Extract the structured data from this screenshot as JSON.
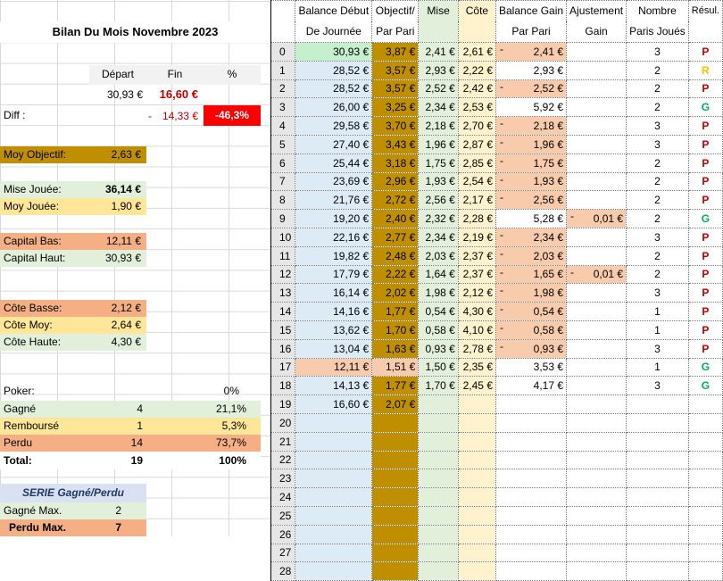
{
  "title": "Bilan Du Mois Novembre 2023",
  "summary": {
    "col_headers": [
      "Départ",
      "Fin",
      "%"
    ],
    "depart": "30,93 €",
    "fin": "16,60 €",
    "diff_label": "Diff :",
    "diff_dash": "-",
    "diff_value": "14,33 €",
    "diff_pct": "-46,3%"
  },
  "stats": {
    "moy_objectif": {
      "label": "Moy Objectif:",
      "value": "2,63 €"
    },
    "mise_jouee": {
      "label": "Mise Jouée:",
      "value": "36,14 €"
    },
    "moy_jouee": {
      "label": "Moy Jouée:",
      "value": "1,90 €"
    },
    "capital_bas": {
      "label": "Capital Bas:",
      "value": "12,11 €"
    },
    "capital_haut": {
      "label": "Capital Haut:",
      "value": "30,93 €"
    },
    "cote_basse": {
      "label": "Côte Basse:",
      "value": "2,12 €"
    },
    "cote_moy": {
      "label": "Côte Moy:",
      "value": "2,64 €"
    },
    "cote_haute": {
      "label": "Côte Haute:",
      "value": "4,30 €"
    }
  },
  "results": {
    "poker": {
      "label": "Poker:",
      "count": "",
      "pct": "0%"
    },
    "gagne": {
      "label": "Gagné",
      "count": "4",
      "pct": "21,1%"
    },
    "rembourse": {
      "label": "Remboursé",
      "count": "1",
      "pct": "5,3%"
    },
    "perdu": {
      "label": "Perdu",
      "count": "14",
      "pct": "73,7%"
    },
    "total": {
      "label": "Total:",
      "count": "19",
      "pct": "100%"
    }
  },
  "serie": {
    "title": "SERIE Gagné/Perdu",
    "gagne_max": {
      "label": "Gagné Max.",
      "value": "2"
    },
    "perdu_max": {
      "label": "Perdu Max.",
      "value": "7"
    }
  },
  "table": {
    "headers": [
      [
        "",
        ""
      ],
      [
        "Balance Début",
        "De Journée"
      ],
      [
        "Objectif/",
        "Par Pari"
      ],
      [
        "Mise",
        ""
      ],
      [
        "Côte",
        ""
      ],
      [
        "Balance Gain",
        "Par Pari"
      ],
      [
        "Ajustement",
        "Gain"
      ],
      [
        "Nombre",
        "Paris Joués"
      ],
      [
        "Résul.",
        ""
      ]
    ],
    "rows": [
      {
        "i": "0",
        "bal": "30,93 €",
        "obj": "3,87 €",
        "mise": "2,41 €",
        "cote": "2,61 €",
        "gain": "2,41 €",
        "gneg": true,
        "adj": "",
        "nb": "3",
        "res": "P",
        "balc": "green"
      },
      {
        "i": "1",
        "bal": "28,52 €",
        "obj": "3,57 €",
        "mise": "2,93 €",
        "cote": "2,22 €",
        "gain": "2,93 €",
        "gneg": false,
        "adj": "",
        "nb": "2",
        "res": "R"
      },
      {
        "i": "2",
        "bal": "28,52 €",
        "obj": "3,57 €",
        "mise": "2,52 €",
        "cote": "2,42 €",
        "gain": "2,52 €",
        "gneg": true,
        "adj": "",
        "nb": "2",
        "res": "P"
      },
      {
        "i": "3",
        "bal": "26,00 €",
        "obj": "3,25 €",
        "mise": "2,34 €",
        "cote": "2,53 €",
        "gain": "5,92 €",
        "gneg": false,
        "adj": "",
        "nb": "2",
        "res": "G"
      },
      {
        "i": "4",
        "bal": "29,58 €",
        "obj": "3,70 €",
        "mise": "2,18 €",
        "cote": "2,70 €",
        "gain": "2,18 €",
        "gneg": true,
        "adj": "",
        "nb": "3",
        "res": "P"
      },
      {
        "i": "5",
        "bal": "27,40 €",
        "obj": "3,43 €",
        "mise": "1,96 €",
        "cote": "2,87 €",
        "gain": "1,96 €",
        "gneg": true,
        "adj": "",
        "nb": "3",
        "res": "P"
      },
      {
        "i": "6",
        "bal": "25,44 €",
        "obj": "3,18 €",
        "mise": "1,75 €",
        "cote": "2,85 €",
        "gain": "1,75 €",
        "gneg": true,
        "adj": "",
        "nb": "2",
        "res": "P"
      },
      {
        "i": "7",
        "bal": "23,69 €",
        "obj": "2,96 €",
        "mise": "1,93 €",
        "cote": "2,54 €",
        "gain": "1,93 €",
        "gneg": true,
        "adj": "",
        "nb": "2",
        "res": "P"
      },
      {
        "i": "8",
        "bal": "21,76 €",
        "obj": "2,72 €",
        "mise": "2,56 €",
        "cote": "2,17 €",
        "gain": "2,56 €",
        "gneg": true,
        "adj": "",
        "nb": "2",
        "res": "P"
      },
      {
        "i": "9",
        "bal": "19,20 €",
        "obj": "2,40 €",
        "mise": "2,32 €",
        "cote": "2,28 €",
        "gain": "5,28 €",
        "gneg": false,
        "adj": "0,01 €",
        "nb": "2",
        "res": "G"
      },
      {
        "i": "10",
        "bal": "22,16 €",
        "obj": "2,77 €",
        "mise": "2,34 €",
        "cote": "2,19 €",
        "gain": "2,34 €",
        "gneg": true,
        "adj": "",
        "nb": "3",
        "res": "P"
      },
      {
        "i": "11",
        "bal": "19,82 €",
        "obj": "2,48 €",
        "mise": "2,03 €",
        "cote": "2,37 €",
        "gain": "2,03 €",
        "gneg": true,
        "adj": "",
        "nb": "2",
        "res": "P"
      },
      {
        "i": "12",
        "bal": "17,79 €",
        "obj": "2,22 €",
        "mise": "1,64 €",
        "cote": "2,37 €",
        "gain": "1,65 €",
        "gneg": true,
        "adj": "0,01 €",
        "nb": "2",
        "res": "P"
      },
      {
        "i": "13",
        "bal": "16,14 €",
        "obj": "2,02 €",
        "mise": "1,98 €",
        "cote": "2,12 €",
        "gain": "1,98 €",
        "gneg": true,
        "adj": "",
        "nb": "3",
        "res": "P"
      },
      {
        "i": "14",
        "bal": "14,16 €",
        "obj": "1,77 €",
        "mise": "0,54 €",
        "cote": "4,30 €",
        "gain": "0,54 €",
        "gneg": true,
        "adj": "",
        "nb": "1",
        "res": "P"
      },
      {
        "i": "15",
        "bal": "13,62 €",
        "obj": "1,70 €",
        "mise": "0,58 €",
        "cote": "4,10 €",
        "gain": "0,58 €",
        "gneg": true,
        "adj": "",
        "nb": "1",
        "res": "P"
      },
      {
        "i": "16",
        "bal": "13,04 €",
        "obj": "1,63 €",
        "mise": "0,93 €",
        "cote": "2,78 €",
        "gain": "0,93 €",
        "gneg": true,
        "adj": "",
        "nb": "3",
        "res": "P"
      },
      {
        "i": "17",
        "bal": "12,11 €",
        "obj": "1,51 €",
        "mise": "1,50 €",
        "cote": "2,35 €",
        "gain": "3,53 €",
        "gneg": false,
        "adj": "",
        "nb": "1",
        "res": "G",
        "balc": "pink",
        "objc": "pink"
      },
      {
        "i": "18",
        "bal": "14,13 €",
        "obj": "1,77 €",
        "mise": "1,70 €",
        "cote": "2,45 €",
        "gain": "4,17 €",
        "gneg": false,
        "adj": "",
        "nb": "3",
        "res": "G"
      },
      {
        "i": "19",
        "bal": "16,60 €",
        "obj": "2,07 €",
        "mise": "",
        "cote": "",
        "gain": "",
        "gneg": false,
        "adj": "",
        "nb": "",
        "res": ""
      },
      {
        "i": "20",
        "bal": "",
        "obj": "",
        "mise": "",
        "cote": "",
        "gain": "",
        "gneg": false,
        "adj": "",
        "nb": "",
        "res": ""
      },
      {
        "i": "21",
        "bal": "",
        "obj": "",
        "mise": "",
        "cote": "",
        "gain": "",
        "gneg": false,
        "adj": "",
        "nb": "",
        "res": ""
      },
      {
        "i": "22",
        "bal": "",
        "obj": "",
        "mise": "",
        "cote": "",
        "gain": "",
        "gneg": false,
        "adj": "",
        "nb": "",
        "res": ""
      },
      {
        "i": "23",
        "bal": "",
        "obj": "",
        "mise": "",
        "cote": "",
        "gain": "",
        "gneg": false,
        "adj": "",
        "nb": "",
        "res": ""
      },
      {
        "i": "24",
        "bal": "",
        "obj": "",
        "mise": "",
        "cote": "",
        "gain": "",
        "gneg": false,
        "adj": "",
        "nb": "",
        "res": ""
      },
      {
        "i": "25",
        "bal": "",
        "obj": "",
        "mise": "",
        "cote": "",
        "gain": "",
        "gneg": false,
        "adj": "",
        "nb": "",
        "res": ""
      },
      {
        "i": "26",
        "bal": "",
        "obj": "",
        "mise": "",
        "cote": "",
        "gain": "",
        "gneg": false,
        "adj": "",
        "nb": "",
        "res": ""
      },
      {
        "i": "27",
        "bal": "",
        "obj": "",
        "mise": "",
        "cote": "",
        "gain": "",
        "gneg": false,
        "adj": "",
        "nb": "",
        "res": ""
      },
      {
        "i": "28",
        "bal": "",
        "obj": "",
        "mise": "",
        "cote": "",
        "gain": "",
        "gneg": false,
        "adj": "",
        "nb": "",
        "res": ""
      }
    ]
  },
  "colors": {
    "objectif_gold": "#bf8f00",
    "loss_pink": "#f8cbad",
    "win_green": "#00b050",
    "loss_red": "#c00000",
    "refund_yellow": "#ffc000",
    "diff_red": "#ff0000"
  }
}
